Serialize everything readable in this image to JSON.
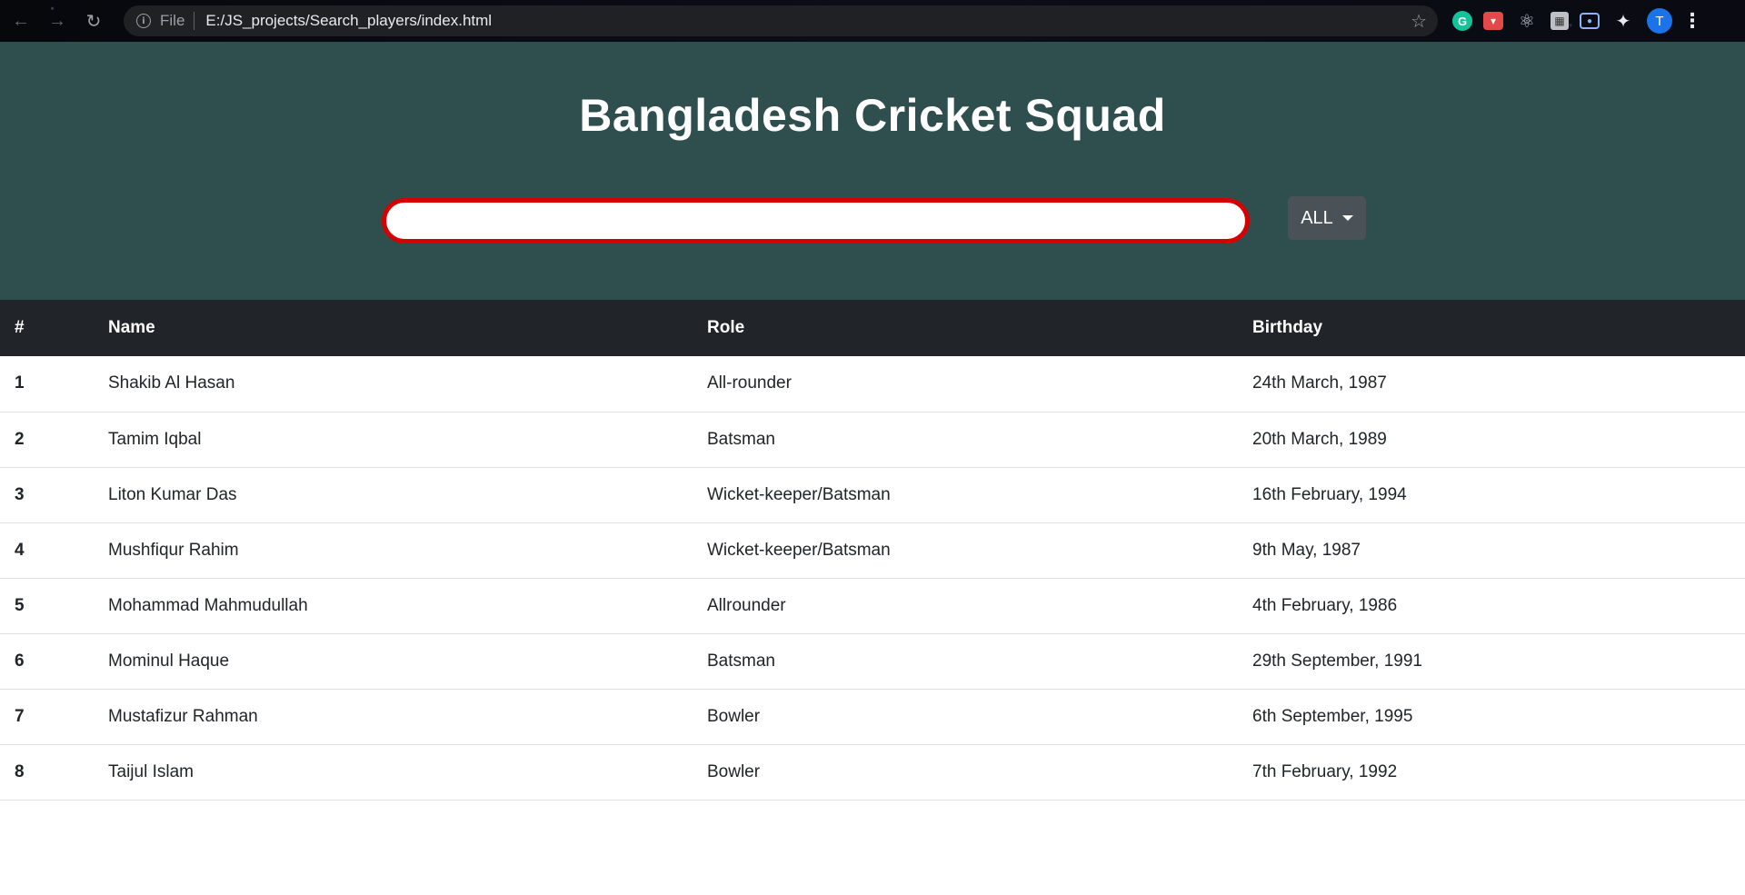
{
  "browser": {
    "scheme": "File",
    "url": "E:/JS_projects/Search_players/index.html",
    "extensions": [
      "grammarly-icon",
      "pocket-icon",
      "react-devtools-icon",
      "extension-icon",
      "screenshot-icon",
      "puzzle-icon"
    ],
    "profile_initial": "T"
  },
  "page": {
    "title": "Bangladesh Cricket Squad",
    "search": {
      "value": "",
      "placeholder": ""
    },
    "filter": {
      "label": "ALL"
    }
  },
  "table": {
    "headers": [
      "#",
      "Name",
      "Role",
      "Birthday"
    ],
    "rows": [
      {
        "num": "1",
        "name": "Shakib Al Hasan",
        "role": "All-rounder",
        "birthday": "24th March, 1987"
      },
      {
        "num": "2",
        "name": "Tamim Iqbal",
        "role": "Batsman",
        "birthday": "20th March, 1989"
      },
      {
        "num": "3",
        "name": "Liton Kumar Das",
        "role": "Wicket-keeper/Batsman",
        "birthday": "16th February, 1994"
      },
      {
        "num": "4",
        "name": "Mushfiqur Rahim",
        "role": "Wicket-keeper/Batsman",
        "birthday": "9th May, 1987"
      },
      {
        "num": "5",
        "name": "Mohammad Mahmudullah",
        "role": "Allrounder",
        "birthday": "4th February, 1986"
      },
      {
        "num": "6",
        "name": "Mominul Haque",
        "role": "Batsman",
        "birthday": "29th September, 1991"
      },
      {
        "num": "7",
        "name": "Mustafizur Rahman",
        "role": "Bowler",
        "birthday": "6th September, 1995"
      },
      {
        "num": "8",
        "name": "Taijul Islam",
        "role": "Bowler",
        "birthday": "7th February, 1992"
      }
    ]
  },
  "colors": {
    "header_bg": "#2f4f4f",
    "table_head_bg": "#212529",
    "search_border": "#d60000",
    "filter_bg": "#4a5157"
  }
}
